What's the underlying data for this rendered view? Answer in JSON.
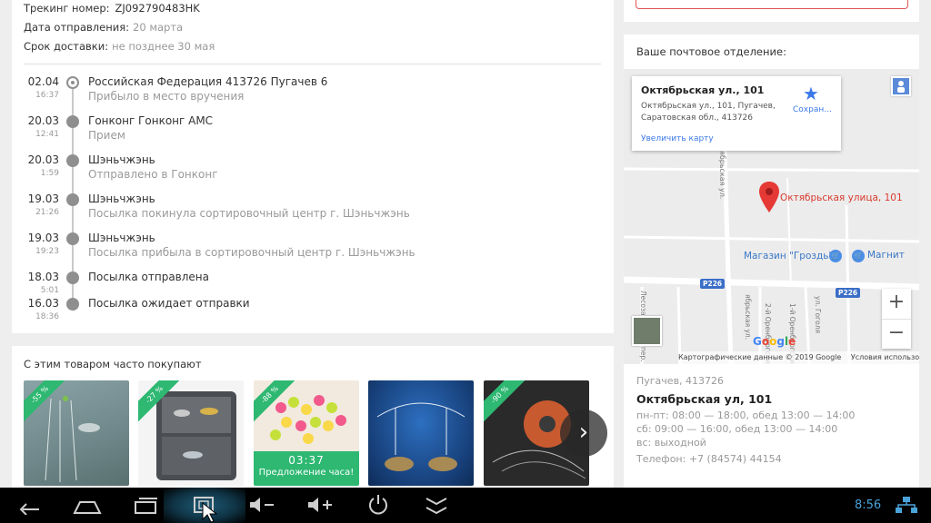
{
  "tracking": {
    "number_label": "Трекинг номер:",
    "number_value": "ZJ092790483HK",
    "sent_label": "Дата отправления:",
    "sent_value": "20 марта",
    "delivery_label": "Срок доставки:",
    "delivery_value": "не позднее 30 мая"
  },
  "events": [
    {
      "date": "02.04",
      "time": "16:37",
      "place": "Российская Федерация 413726 Пугачев 6",
      "status": "Прибыло в место вручения"
    },
    {
      "date": "20.03",
      "time": "12:41",
      "place": "Гонконг Гонконг АМС",
      "status": "Прием"
    },
    {
      "date": "20.03",
      "time": "1:59",
      "place": "Шэньчжэнь",
      "status": "Отправлено в Гонконг"
    },
    {
      "date": "19.03",
      "time": "21:26",
      "place": "Шэньчжэнь",
      "status": "Посылка покинула сортировочный центр г. Шэньчжэнь"
    },
    {
      "date": "19.03",
      "time": "19:23",
      "place": "Шэньчжэнь",
      "status": "Посылка прибыла в сортировочный центр г. Шэньчжэнь"
    },
    {
      "date": "18.03",
      "time": "5:01",
      "place": "Посылка отправлена",
      "status": ""
    },
    {
      "date": "16.03",
      "time": "18:36",
      "place": "Посылка ожидает отправки",
      "status": ""
    }
  ],
  "also": {
    "title": "С этим товаром часто покупают",
    "products": [
      {
        "discount": "-55 %"
      },
      {
        "discount": "-27 %"
      },
      {
        "discount": "-88 %",
        "deal_timer": "03:37",
        "deal_label": "Предложение часа!"
      },
      {
        "discount": ""
      },
      {
        "discount": "-90 %"
      }
    ],
    "next_icon": "chevron-right-icon"
  },
  "office": {
    "title": "Ваше почтовое отделение:",
    "map": {
      "popup_title": "Октябрьская ул., 101",
      "popup_address": "Октябрьская ул., 101, Пугачев, Саратовская обл., 413726",
      "popup_link": "Увеличить карту",
      "popup_save": "Сохран...",
      "marker_label": "Октябрьская улица, 101",
      "poi_1": "Магазин \"Гроздь\"",
      "poi_2": "Магнит",
      "road_1": "P226",
      "road_2": "P226",
      "street_1": "ябрьская ул.",
      "street_2": "ул. Гоголя",
      "street_3": "Лесозащитный пер.",
      "street_4": "2-й Оренбургский",
      "street_5": "1-й Оренбургский",
      "google": "Google",
      "footer_data": "Картографические данные © 2019 Google",
      "footer_terms": "Условия использования",
      "zoom_in": "+",
      "zoom_out": "−"
    },
    "city": "Пугачев, 413726",
    "name": "Октябрьская ул, 101",
    "hours_1": "пн-пт: 08:00 — 18:00, обед 13:00 — 14:00",
    "hours_2": "сб: 09:00 — 16:00, обед 13:00 — 14:00",
    "hours_3": "вс: выходной",
    "phone": "Телефон: +7 (84574) 44154"
  },
  "navbar": {
    "clock": "8:56",
    "icons": [
      "back-icon",
      "home-icon",
      "recents-icon",
      "screenshot-icon",
      "volume-down-icon",
      "volume-up-icon",
      "power-icon",
      "collapse-icon",
      "network-icon"
    ]
  },
  "colors": {
    "accent_green": "#2eb872",
    "map_marker": "#e53935",
    "link_blue": "#3b78e7",
    "clock_blue": "#4aa3d8"
  }
}
